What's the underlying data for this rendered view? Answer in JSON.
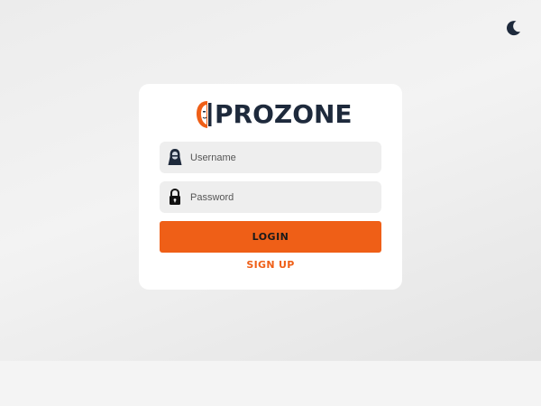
{
  "brand": {
    "logo_text": "PROZONE",
    "accent_color": "#ef5f17",
    "text_color": "#1e2a3c"
  },
  "header": {
    "theme_toggle_icon": "moon-icon"
  },
  "form": {
    "username": {
      "placeholder": "Username",
      "value": "",
      "icon": "hacker-avatar-icon"
    },
    "password": {
      "placeholder": "Password",
      "value": "",
      "icon": "lock-icon"
    },
    "login_label": "LOGIN",
    "signup_label": "SIGN UP"
  }
}
